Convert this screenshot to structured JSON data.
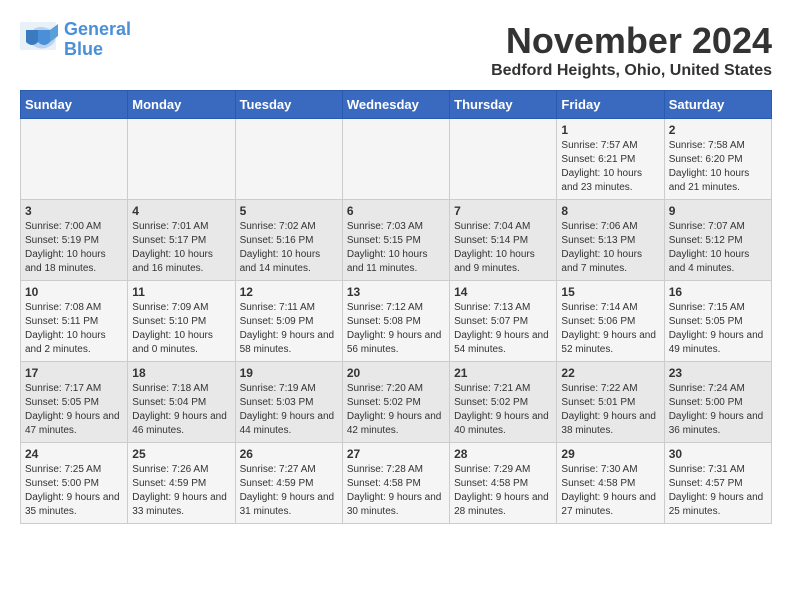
{
  "logo": {
    "line1": "General",
    "line2": "Blue"
  },
  "title": "November 2024",
  "location": "Bedford Heights, Ohio, United States",
  "days_of_week": [
    "Sunday",
    "Monday",
    "Tuesday",
    "Wednesday",
    "Thursday",
    "Friday",
    "Saturday"
  ],
  "weeks": [
    [
      {
        "day": "",
        "content": ""
      },
      {
        "day": "",
        "content": ""
      },
      {
        "day": "",
        "content": ""
      },
      {
        "day": "",
        "content": ""
      },
      {
        "day": "",
        "content": ""
      },
      {
        "day": "1",
        "content": "Sunrise: 7:57 AM\nSunset: 6:21 PM\nDaylight: 10 hours and 23 minutes."
      },
      {
        "day": "2",
        "content": "Sunrise: 7:58 AM\nSunset: 6:20 PM\nDaylight: 10 hours and 21 minutes."
      }
    ],
    [
      {
        "day": "3",
        "content": "Sunrise: 7:00 AM\nSunset: 5:19 PM\nDaylight: 10 hours and 18 minutes."
      },
      {
        "day": "4",
        "content": "Sunrise: 7:01 AM\nSunset: 5:17 PM\nDaylight: 10 hours and 16 minutes."
      },
      {
        "day": "5",
        "content": "Sunrise: 7:02 AM\nSunset: 5:16 PM\nDaylight: 10 hours and 14 minutes."
      },
      {
        "day": "6",
        "content": "Sunrise: 7:03 AM\nSunset: 5:15 PM\nDaylight: 10 hours and 11 minutes."
      },
      {
        "day": "7",
        "content": "Sunrise: 7:04 AM\nSunset: 5:14 PM\nDaylight: 10 hours and 9 minutes."
      },
      {
        "day": "8",
        "content": "Sunrise: 7:06 AM\nSunset: 5:13 PM\nDaylight: 10 hours and 7 minutes."
      },
      {
        "day": "9",
        "content": "Sunrise: 7:07 AM\nSunset: 5:12 PM\nDaylight: 10 hours and 4 minutes."
      }
    ],
    [
      {
        "day": "10",
        "content": "Sunrise: 7:08 AM\nSunset: 5:11 PM\nDaylight: 10 hours and 2 minutes."
      },
      {
        "day": "11",
        "content": "Sunrise: 7:09 AM\nSunset: 5:10 PM\nDaylight: 10 hours and 0 minutes."
      },
      {
        "day": "12",
        "content": "Sunrise: 7:11 AM\nSunset: 5:09 PM\nDaylight: 9 hours and 58 minutes."
      },
      {
        "day": "13",
        "content": "Sunrise: 7:12 AM\nSunset: 5:08 PM\nDaylight: 9 hours and 56 minutes."
      },
      {
        "day": "14",
        "content": "Sunrise: 7:13 AM\nSunset: 5:07 PM\nDaylight: 9 hours and 54 minutes."
      },
      {
        "day": "15",
        "content": "Sunrise: 7:14 AM\nSunset: 5:06 PM\nDaylight: 9 hours and 52 minutes."
      },
      {
        "day": "16",
        "content": "Sunrise: 7:15 AM\nSunset: 5:05 PM\nDaylight: 9 hours and 49 minutes."
      }
    ],
    [
      {
        "day": "17",
        "content": "Sunrise: 7:17 AM\nSunset: 5:05 PM\nDaylight: 9 hours and 47 minutes."
      },
      {
        "day": "18",
        "content": "Sunrise: 7:18 AM\nSunset: 5:04 PM\nDaylight: 9 hours and 46 minutes."
      },
      {
        "day": "19",
        "content": "Sunrise: 7:19 AM\nSunset: 5:03 PM\nDaylight: 9 hours and 44 minutes."
      },
      {
        "day": "20",
        "content": "Sunrise: 7:20 AM\nSunset: 5:02 PM\nDaylight: 9 hours and 42 minutes."
      },
      {
        "day": "21",
        "content": "Sunrise: 7:21 AM\nSunset: 5:02 PM\nDaylight: 9 hours and 40 minutes."
      },
      {
        "day": "22",
        "content": "Sunrise: 7:22 AM\nSunset: 5:01 PM\nDaylight: 9 hours and 38 minutes."
      },
      {
        "day": "23",
        "content": "Sunrise: 7:24 AM\nSunset: 5:00 PM\nDaylight: 9 hours and 36 minutes."
      }
    ],
    [
      {
        "day": "24",
        "content": "Sunrise: 7:25 AM\nSunset: 5:00 PM\nDaylight: 9 hours and 35 minutes."
      },
      {
        "day": "25",
        "content": "Sunrise: 7:26 AM\nSunset: 4:59 PM\nDaylight: 9 hours and 33 minutes."
      },
      {
        "day": "26",
        "content": "Sunrise: 7:27 AM\nSunset: 4:59 PM\nDaylight: 9 hours and 31 minutes."
      },
      {
        "day": "27",
        "content": "Sunrise: 7:28 AM\nSunset: 4:58 PM\nDaylight: 9 hours and 30 minutes."
      },
      {
        "day": "28",
        "content": "Sunrise: 7:29 AM\nSunset: 4:58 PM\nDaylight: 9 hours and 28 minutes."
      },
      {
        "day": "29",
        "content": "Sunrise: 7:30 AM\nSunset: 4:58 PM\nDaylight: 9 hours and 27 minutes."
      },
      {
        "day": "30",
        "content": "Sunrise: 7:31 AM\nSunset: 4:57 PM\nDaylight: 9 hours and 25 minutes."
      }
    ]
  ]
}
